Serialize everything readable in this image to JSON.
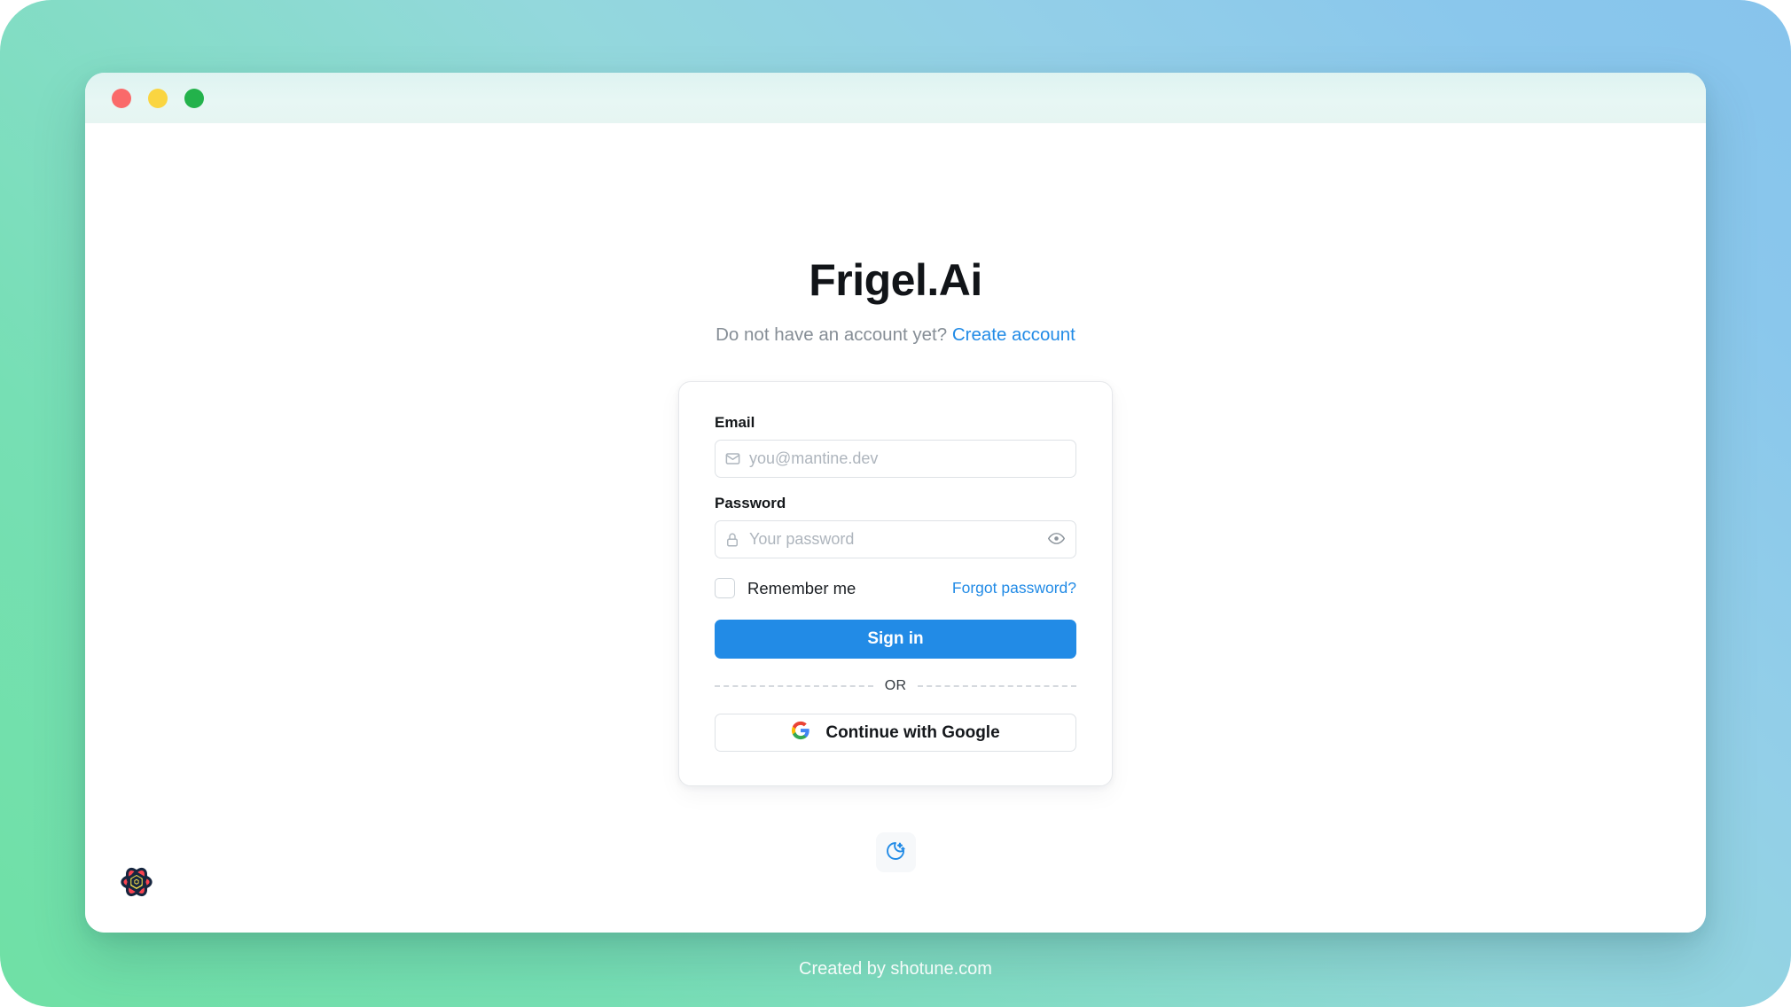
{
  "window": {
    "traffic_lights": [
      {
        "name": "close",
        "color": "#fa6a6a"
      },
      {
        "name": "minimize",
        "color": "#fad541"
      },
      {
        "name": "maximize",
        "color": "#23b24b"
      }
    ]
  },
  "page": {
    "title": "Frigel.Ai",
    "subtitle_text": "Do not have an account yet?",
    "subtitle_link": "Create account"
  },
  "form": {
    "email": {
      "label": "Email",
      "placeholder": "you@mantine.dev",
      "value": "",
      "icon": "mail-icon"
    },
    "password": {
      "label": "Password",
      "placeholder": "Your password",
      "value": "",
      "icon": "lock-icon",
      "reveal_icon": "eye-icon"
    },
    "remember_me": {
      "label": "Remember me",
      "checked": false
    },
    "forgot_password": "Forgot password?",
    "submit": "Sign in",
    "divider": "OR",
    "google": {
      "label": "Continue with Google",
      "icon": "google-g-icon"
    }
  },
  "theme_toggle": {
    "icon": "moon-stars-icon",
    "accent": "#228be6"
  },
  "branding": {
    "logo_icon": "mantine-flower-logo"
  },
  "footer": {
    "text": "Created by shotune.com"
  },
  "colors": {
    "accent": "#228be6",
    "gradient_start": "#6fe0a5",
    "gradient_end": "#87c4ec",
    "titlebar": "#e6f5f2"
  }
}
